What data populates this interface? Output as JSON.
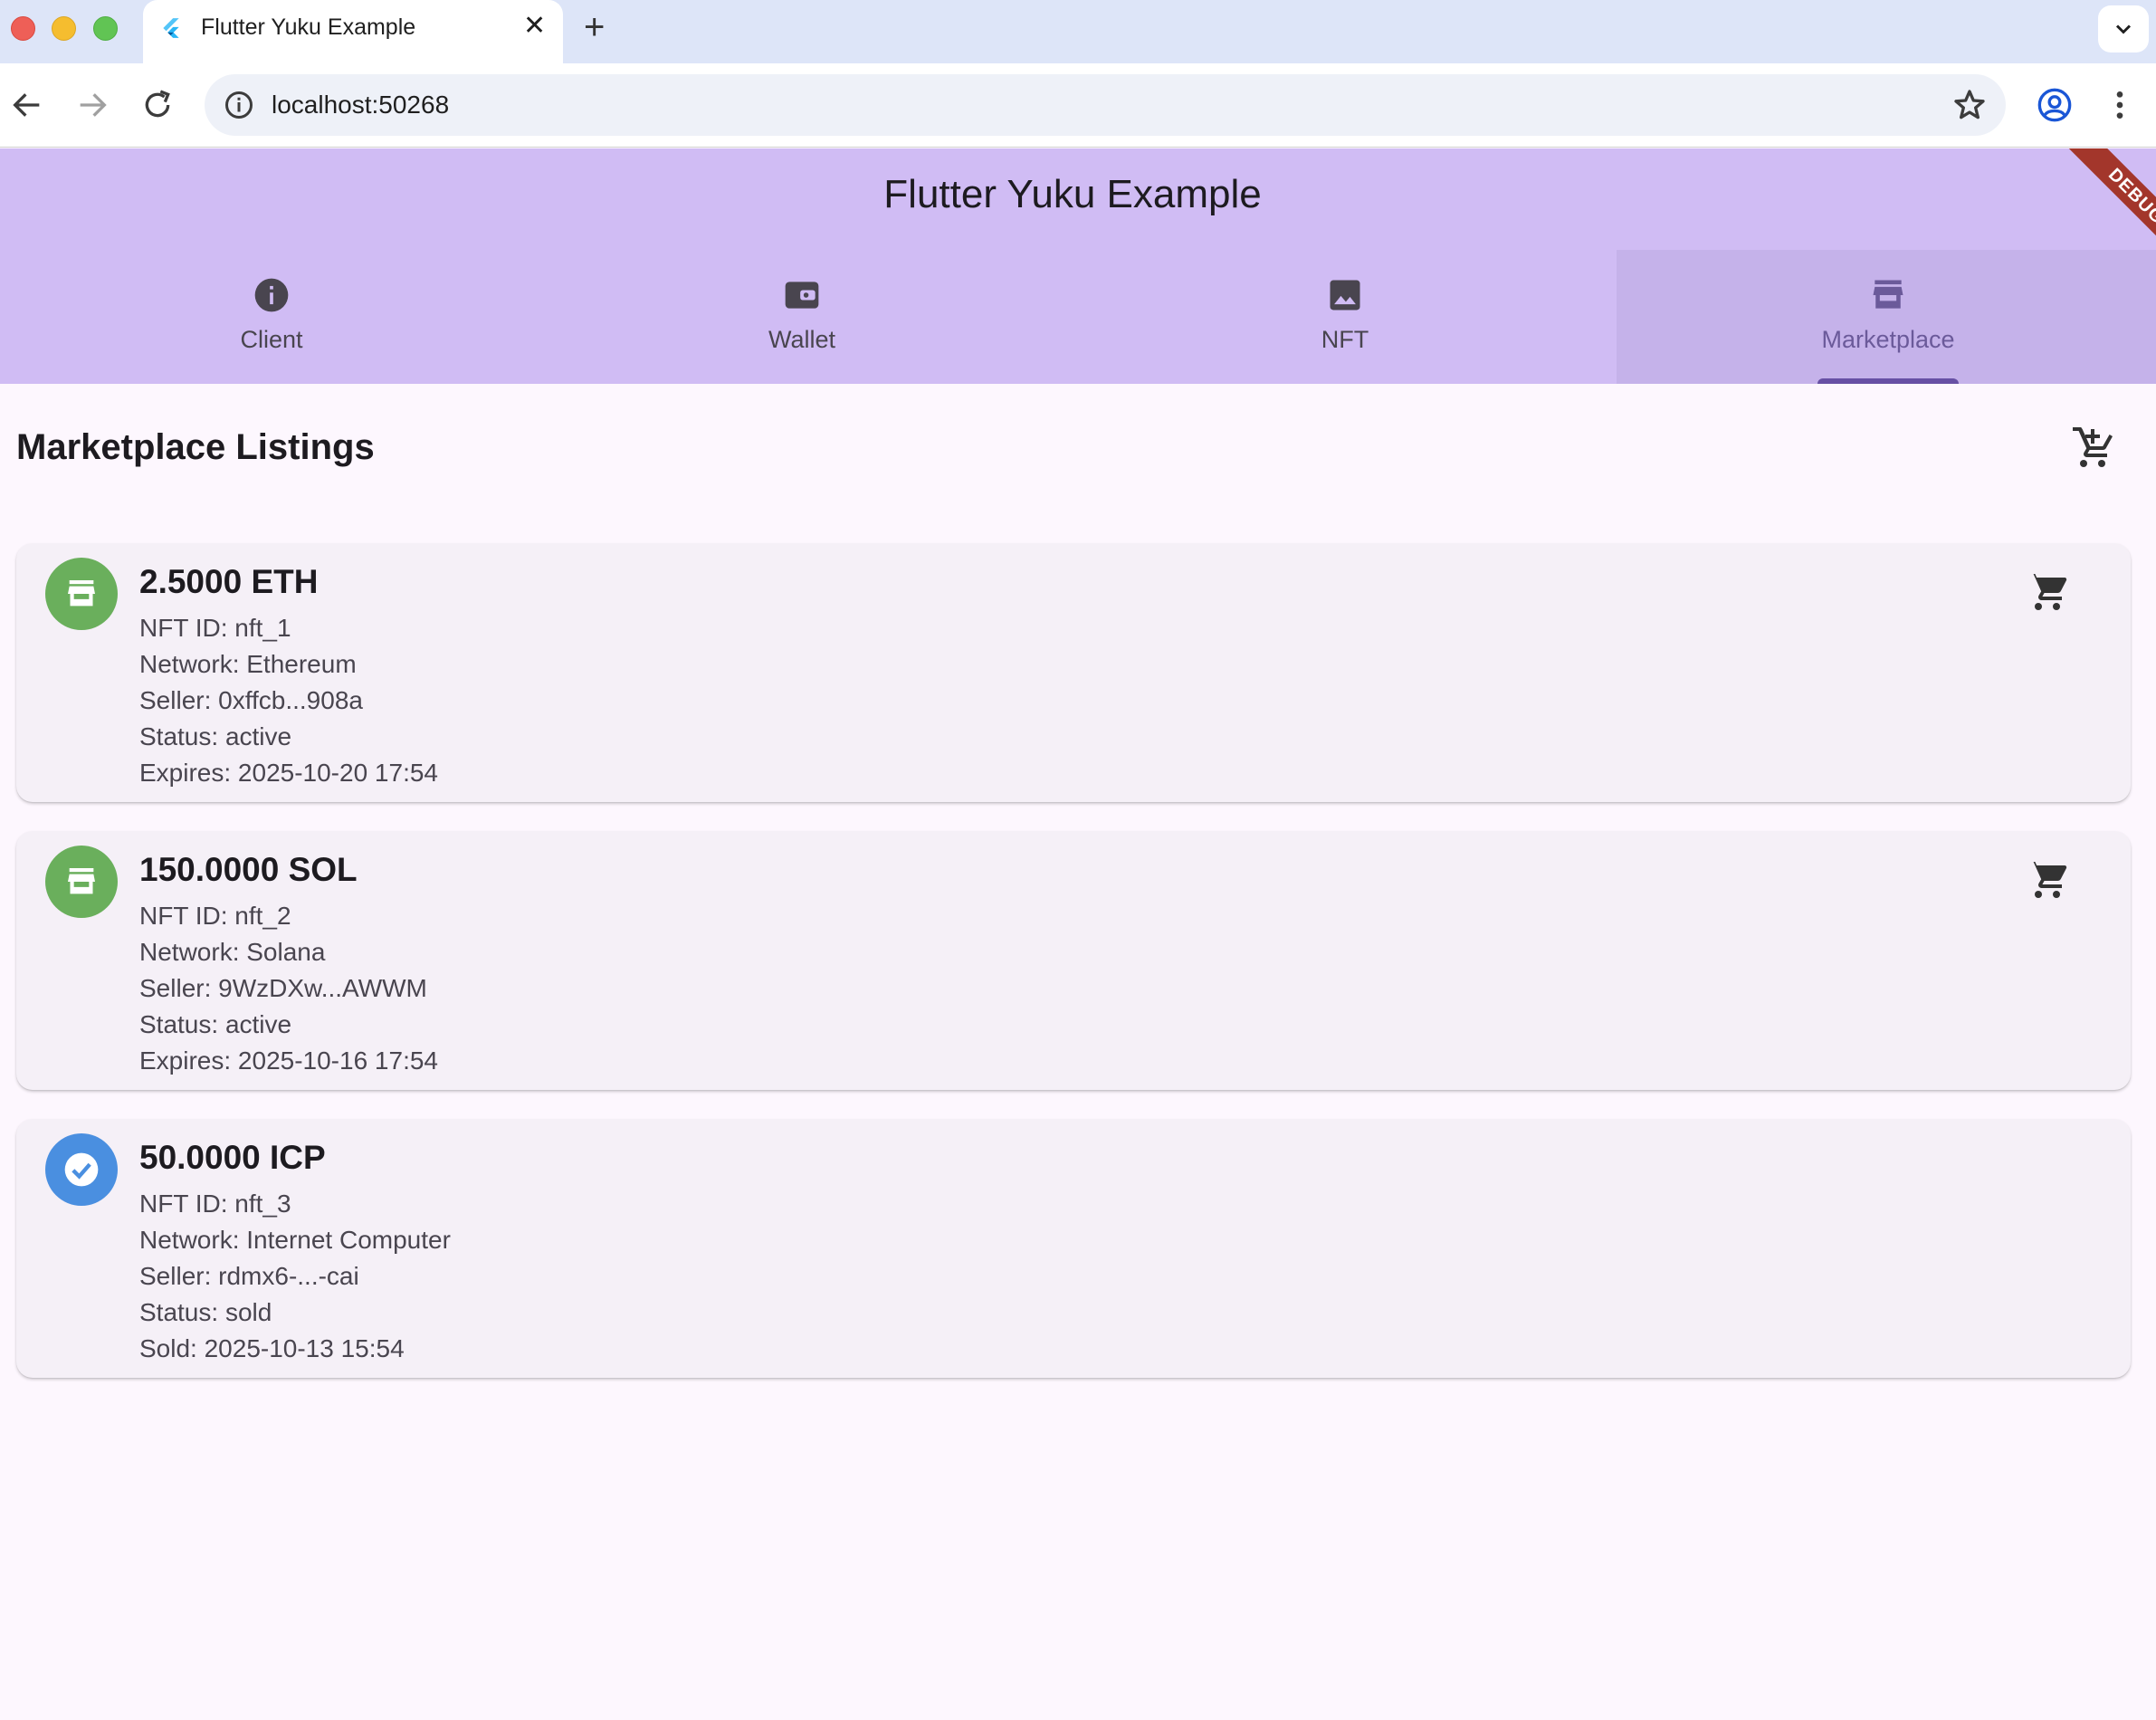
{
  "browser": {
    "tab_title": "Flutter Yuku Example",
    "url": "localhost:50268"
  },
  "app": {
    "title": "Flutter Yuku Example",
    "debug_label": "DEBUG",
    "tabs": [
      {
        "label": "Client",
        "icon": "info-icon"
      },
      {
        "label": "Wallet",
        "icon": "wallet-icon"
      },
      {
        "label": "NFT",
        "icon": "image-icon"
      },
      {
        "label": "Marketplace",
        "icon": "storefront-icon",
        "selected": true
      }
    ]
  },
  "marketplace": {
    "title": "Marketplace Listings",
    "listings": [
      {
        "price": "2.5000 ETH",
        "nft_id": "NFT ID: nft_1",
        "network": "Network: Ethereum",
        "seller": "Seller: 0xffcb...908a",
        "status": "Status: active",
        "date": "Expires: 2025-10-20 17:54",
        "avatar_color": "#6aaf5c",
        "icon": "storefront-icon"
      },
      {
        "price": "150.0000 SOL",
        "nft_id": "NFT ID: nft_2",
        "network": "Network: Solana",
        "seller": "Seller: 9WzDXw...AWWM",
        "status": "Status: active",
        "date": "Expires: 2025-10-16 17:54",
        "avatar_color": "#6aaf5c",
        "icon": "storefront-icon"
      },
      {
        "price": "50.0000 ICP",
        "nft_id": "NFT ID: nft_3",
        "network": "Network: Internet Computer",
        "seller": "Seller: rdmx6-...-cai",
        "status": "Status: sold",
        "date": "Sold: 2025-10-13 15:54",
        "avatar_color": "#4a8fe0",
        "icon": "check-circle-icon"
      }
    ]
  },
  "colors": {
    "app_bar": "#d0bcf4",
    "selected_tab": "#c5b2ea",
    "indicator": "#6750a4",
    "background": "#fdf7fe",
    "card": "#f5f0f7"
  }
}
